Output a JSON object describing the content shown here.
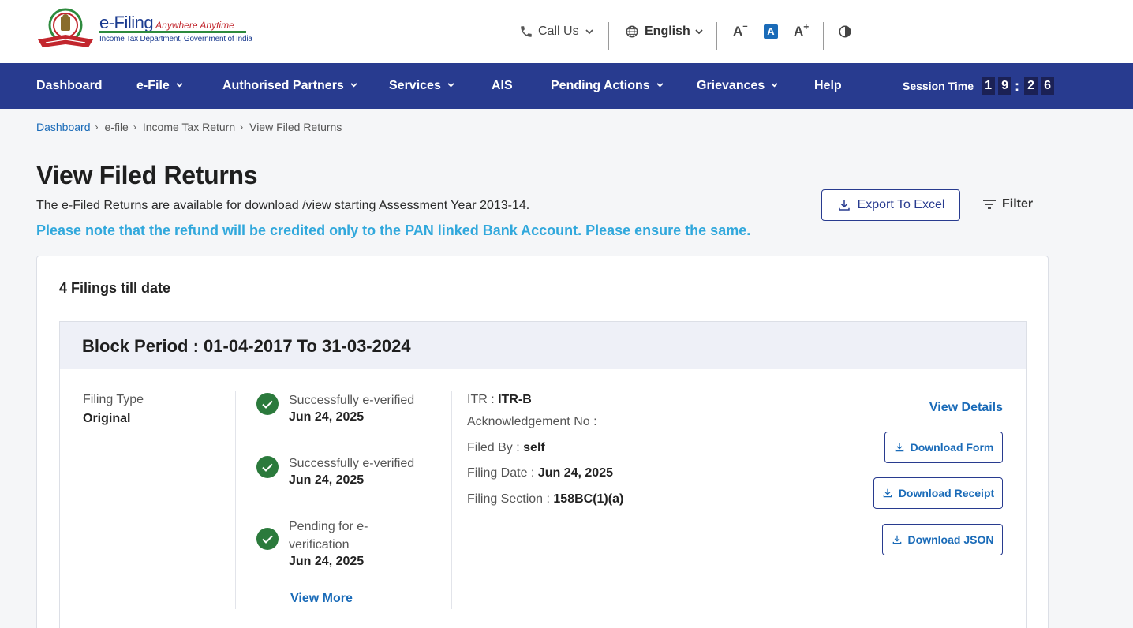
{
  "header": {
    "brand_main": "e-Filing",
    "brand_tag": "Anywhere Anytime",
    "brand_sub": "Income Tax Department, Government of India",
    "call_us": "Call Us",
    "language": "English",
    "font_decrease": "A",
    "font_reset": "A",
    "font_increase": "A"
  },
  "nav": {
    "items": [
      {
        "label": "Dashboard",
        "dropdown": false
      },
      {
        "label": "e-File",
        "dropdown": true
      },
      {
        "label": "Authorised Partners",
        "dropdown": true
      },
      {
        "label": "Services",
        "dropdown": true
      },
      {
        "label": "AIS",
        "dropdown": false
      },
      {
        "label": "Pending Actions",
        "dropdown": true
      },
      {
        "label": "Grievances",
        "dropdown": true
      },
      {
        "label": "Help",
        "dropdown": false
      }
    ],
    "session_label": "Session Time",
    "session_digits": [
      "1",
      "9",
      "2",
      "6"
    ]
  },
  "breadcrumb": [
    "Dashboard",
    "e-file",
    "Income Tax Return",
    "View Filed Returns"
  ],
  "page": {
    "title": "View Filed Returns",
    "subtitle": "The e-Filed Returns are available for download /view starting Assessment Year 2013-14.",
    "notice": "Please note that the refund will be credited only to the PAN linked Bank Account. Please ensure the same.",
    "export_label": "Export To Excel",
    "filter_label": "Filter"
  },
  "filings": {
    "count_text": "4 Filings till date",
    "block_title": "Block Period : 01-04-2017 To 31-03-2024",
    "filing_type_label": "Filing Type",
    "filing_type_value": "Original",
    "timeline": [
      {
        "status": "Successfully e-verified",
        "date": "Jun 24, 2025"
      },
      {
        "status": "Successfully e-verified",
        "date": "Jun 24, 2025"
      },
      {
        "status": "Pending for e-verification",
        "date": "Jun 24, 2025"
      }
    ],
    "view_more": "View More",
    "itr_label": "ITR : ",
    "itr_value": "ITR-B",
    "ack_label": "Acknowledgement No :",
    "filed_by_label": "Filed By : ",
    "filed_by_value": "self",
    "filing_date_label": "Filing Date : ",
    "filing_date_value": "Jun 24, 2025",
    "filing_section_label": "Filing Section : ",
    "filing_section_value": "158BC(1)(a)",
    "view_details": "View Details",
    "download_form": "Download Form",
    "download_receipt": "Download Receipt",
    "download_json": "Download JSON"
  },
  "colors": {
    "nav_bg": "#283b8f",
    "notice": "#31a8dc",
    "link": "#1a6bb8",
    "success": "#2b7a3c"
  }
}
